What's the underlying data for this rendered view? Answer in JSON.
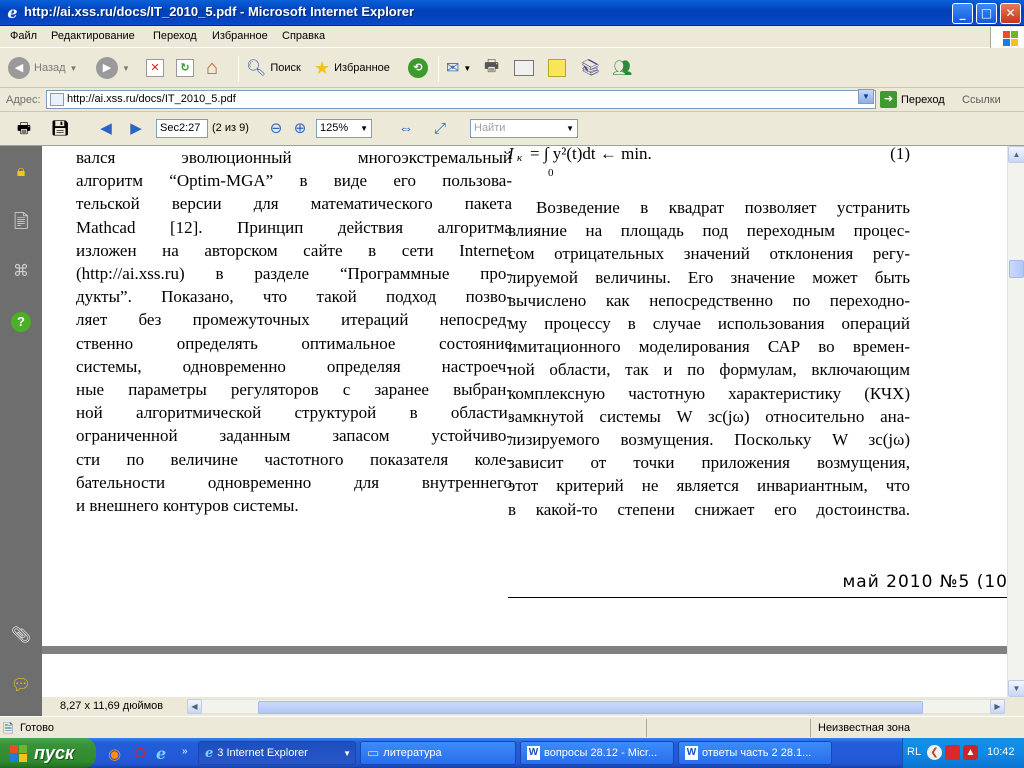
{
  "window": {
    "title": "http://ai.xss.ru/docs/IT_2010_5.pdf - Microsoft Internet Explorer",
    "controls": {
      "minimize": "_",
      "maximize": "□",
      "close": "✕"
    }
  },
  "menu": [
    "Файл",
    "Редактирование",
    "Переход",
    "Избранное",
    "Справка"
  ],
  "toolbar": {
    "back": "Назад",
    "search": "Поиск",
    "favorites": "Избранное"
  },
  "address": {
    "label": "Адрес:",
    "url": "http://ai.xss.ru/docs/IT_2010_5.pdf",
    "go": "Переход",
    "links": "Ссылки"
  },
  "pdf_toolbar": {
    "page_field": "Sec2:27",
    "page_count": "(2 из 9)",
    "zoom": "125%",
    "find_placeholder": "Найти"
  },
  "document": {
    "left_column": [
      "вался эволюционный многоэкстремальный",
      "алгоритм “Optim-MGA” в виде его пользова-",
      "тельской версии для математического пакета",
      "Mathcad [12]. Принцип действия алгоритма",
      "изложен на авторском сайте в сети Internet",
      "(http://ai.xss.ru) в разделе “Программные про-",
      "дукты”. Показано, что такой подход позво-",
      "ляет без промежуточных итераций непосред-",
      "ственно определять оптимальное состояние",
      "системы, одновременно определяя настроеч-",
      "ные параметры регуляторов с заранее выбран-",
      "ной алгоритмической структурой в области,",
      "ограниченной заданным запасом устойчиво-",
      "сти по величине частотного показателя коле-",
      "бательности одновременно для внутреннего",
      "и внешнего контуров системы."
    ],
    "formula": {
      "lhs": "I",
      "sub": "к",
      "integrand": "= ∫ y²(t)dt ← min.",
      "lower": "0",
      "number": "(1)"
    },
    "right_column": [
      "Возведение в квадрат позволяет устранить",
      "влияние на площадь под переходным процес-",
      "сом отрицательных значений отклонения регу-",
      "лируемой величины. Его значение может быть",
      "вычислено как непосредственно по переходно-",
      "му процессу в случае использования операций",
      "имитационного моделирования САР во времен-",
      "ной области, так и по формулам, включающим",
      "комплексную частотную характеристику (КЧХ)",
      "замкнутой системы W зс(jω) относительно ана-",
      "лизируемого возмущения. Поскольку W зс(jω)",
      "зависит от точки приложения возмущения,",
      "этот критерий не является инвариантным, что",
      "в какой-то степени снижает его достоинства."
    ],
    "footer": "май 2010 №5 (10"
  },
  "page_size": "8,27 x 11,69 дюймов",
  "status": {
    "text": "Готово",
    "zone": "Неизвестная зона"
  },
  "taskbar": {
    "start": "пуск",
    "tasks": [
      "3 Internet Explorer",
      "литература",
      "вопросы 28.12 - Micr...",
      "ответы часть 2 28.1..."
    ],
    "lang": "RL",
    "clock": "10:42"
  }
}
